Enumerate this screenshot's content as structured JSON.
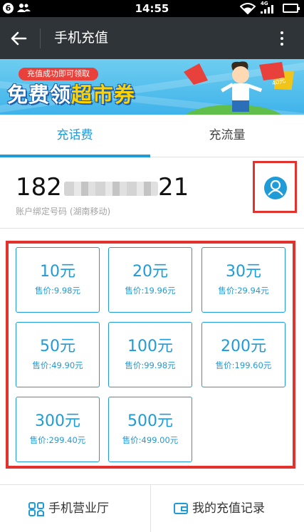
{
  "status_bar": {
    "notification_count": "6",
    "time": "14:55",
    "network": "4G"
  },
  "header": {
    "title": "手机充值"
  },
  "banner": {
    "pill_text": "充值成功即可领取",
    "title_pre": "免费领",
    "title_highlight": "超市券",
    "tag_text": "40元"
  },
  "tabs": [
    {
      "label": "充话费",
      "active": true
    },
    {
      "label": "充流量",
      "active": false
    }
  ],
  "account": {
    "number_prefix": "182",
    "number_suffix": "21",
    "caption": "账户绑定号码 (湖南移动)"
  },
  "amounts": [
    {
      "face": "10元",
      "price": "售价:9.98元"
    },
    {
      "face": "20元",
      "price": "售价:19.96元"
    },
    {
      "face": "30元",
      "price": "售价:29.94元"
    },
    {
      "face": "50元",
      "price": "售价:49.90元"
    },
    {
      "face": "100元",
      "price": "售价:99.98元"
    },
    {
      "face": "200元",
      "price": "售价:199.60元"
    },
    {
      "face": "300元",
      "price": "售价:299.40元"
    },
    {
      "face": "500元",
      "price": "售价:499.00元"
    }
  ],
  "bottom_links": {
    "store": "手机营业厅",
    "records": "我的充值记录"
  },
  "colors": {
    "accent": "#1f9bd8",
    "header_bg": "#2f3438",
    "highlight_red": "#e2322d"
  }
}
